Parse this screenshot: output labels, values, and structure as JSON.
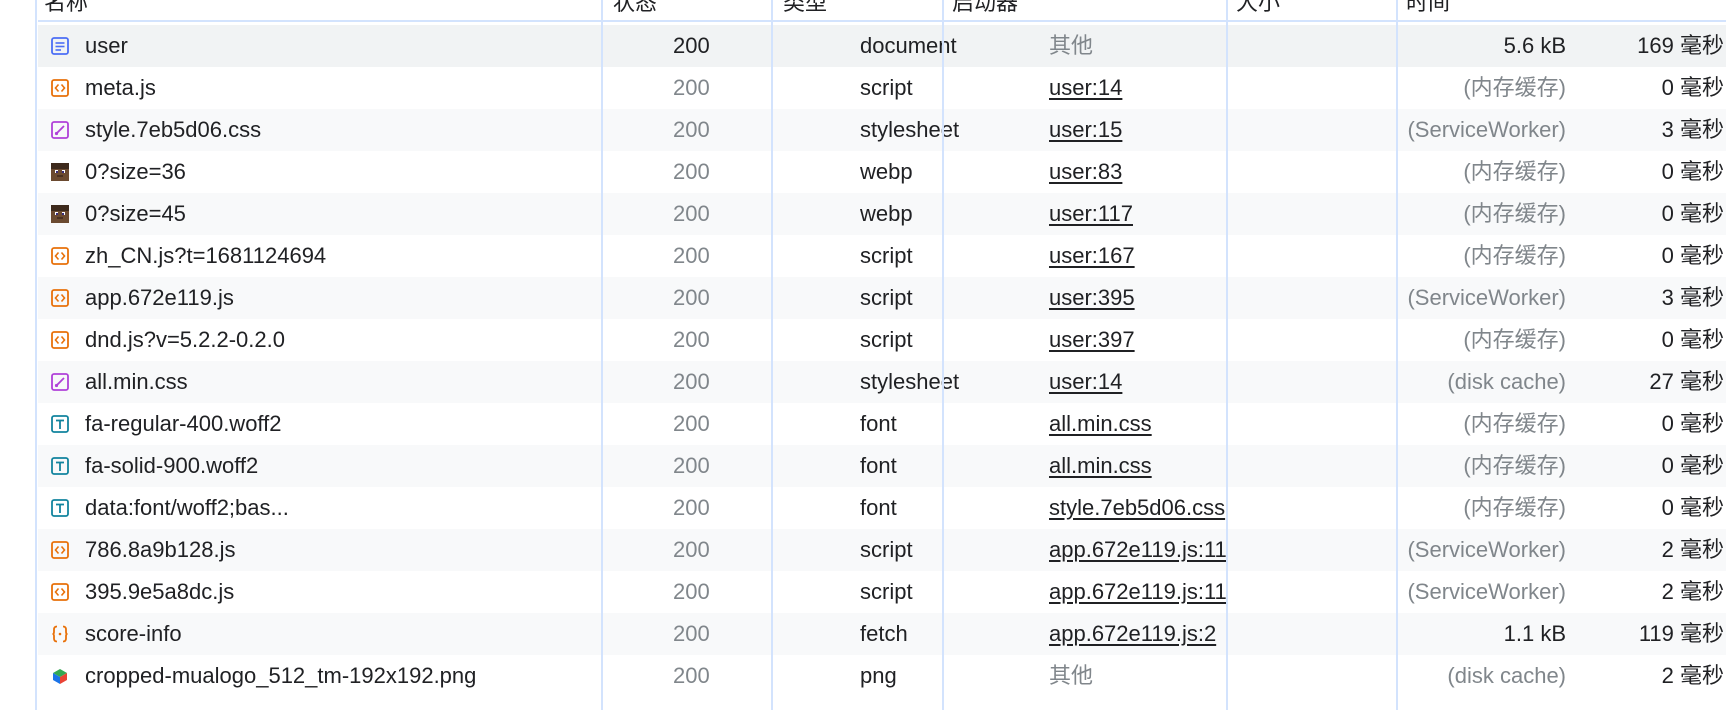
{
  "header": {
    "name": "名称",
    "status": "状态",
    "type": "类型",
    "initiator": "启动器",
    "size": "大小",
    "time": "时间"
  },
  "rows": [
    {
      "name": "user",
      "status": "200",
      "type": "document",
      "initiator": "其他",
      "initiator_link": false,
      "size": "5.6 kB",
      "size_dim": false,
      "time": "169 毫秒",
      "icon": "document-icon"
    },
    {
      "name": "meta.js",
      "status": "200",
      "type": "script",
      "initiator": "user:14",
      "initiator_link": true,
      "size": "(内存缓存)",
      "size_dim": true,
      "time": "0 毫秒",
      "icon": "script-icon"
    },
    {
      "name": "style.7eb5d06.css",
      "status": "200",
      "type": "stylesheet",
      "initiator": "user:15",
      "initiator_link": true,
      "size": "(ServiceWorker)",
      "size_dim": true,
      "time": "3 毫秒",
      "icon": "stylesheet-icon"
    },
    {
      "name": "0?size=36",
      "status": "200",
      "type": "webp",
      "initiator": "user:83",
      "initiator_link": true,
      "size": "(内存缓存)",
      "size_dim": true,
      "time": "0 毫秒",
      "icon": "avatar-image-icon"
    },
    {
      "name": "0?size=45",
      "status": "200",
      "type": "webp",
      "initiator": "user:117",
      "initiator_link": true,
      "size": "(内存缓存)",
      "size_dim": true,
      "time": "0 毫秒",
      "icon": "avatar-image-icon"
    },
    {
      "name": "zh_CN.js?t=1681124694",
      "status": "200",
      "type": "script",
      "initiator": "user:167",
      "initiator_link": true,
      "size": "(内存缓存)",
      "size_dim": true,
      "time": "0 毫秒",
      "icon": "script-icon"
    },
    {
      "name": "app.672e119.js",
      "status": "200",
      "type": "script",
      "initiator": "user:395",
      "initiator_link": true,
      "size": "(ServiceWorker)",
      "size_dim": true,
      "time": "3 毫秒",
      "icon": "script-icon"
    },
    {
      "name": "dnd.js?v=5.2.2-0.2.0",
      "status": "200",
      "type": "script",
      "initiator": "user:397",
      "initiator_link": true,
      "size": "(内存缓存)",
      "size_dim": true,
      "time": "0 毫秒",
      "icon": "script-icon"
    },
    {
      "name": "all.min.css",
      "status": "200",
      "type": "stylesheet",
      "initiator": "user:14",
      "initiator_link": true,
      "size": "(disk cache)",
      "size_dim": true,
      "time": "27 毫秒",
      "icon": "stylesheet-icon"
    },
    {
      "name": "fa-regular-400.woff2",
      "status": "200",
      "type": "font",
      "initiator": "all.min.css",
      "initiator_link": true,
      "size": "(内存缓存)",
      "size_dim": true,
      "time": "0 毫秒",
      "icon": "font-icon"
    },
    {
      "name": "fa-solid-900.woff2",
      "status": "200",
      "type": "font",
      "initiator": "all.min.css",
      "initiator_link": true,
      "size": "(内存缓存)",
      "size_dim": true,
      "time": "0 毫秒",
      "icon": "font-icon"
    },
    {
      "name": "data:font/woff2;bas...",
      "status": "200",
      "type": "font",
      "initiator": "style.7eb5d06.css",
      "initiator_link": true,
      "size": "(内存缓存)",
      "size_dim": true,
      "time": "0 毫秒",
      "icon": "font-icon"
    },
    {
      "name": "786.8a9b128.js",
      "status": "200",
      "type": "script",
      "initiator": "app.672e119.js:11",
      "initiator_link": true,
      "size": "(ServiceWorker)",
      "size_dim": true,
      "time": "2 毫秒",
      "icon": "script-icon"
    },
    {
      "name": "395.9e5a8dc.js",
      "status": "200",
      "type": "script",
      "initiator": "app.672e119.js:11",
      "initiator_link": true,
      "size": "(ServiceWorker)",
      "size_dim": true,
      "time": "2 毫秒",
      "icon": "script-icon"
    },
    {
      "name": "score-info",
      "status": "200",
      "type": "fetch",
      "initiator": "app.672e119.js:2",
      "initiator_link": true,
      "size": "1.1 kB",
      "size_dim": false,
      "time": "119 毫秒",
      "icon": "fetch-icon"
    },
    {
      "name": "cropped-mualogo_512_tm-192x192.png",
      "status": "200",
      "type": "png",
      "initiator": "其他",
      "initiator_link": false,
      "size": "(disk cache)",
      "size_dim": true,
      "time": "2 毫秒",
      "icon": "image-icon"
    }
  ],
  "colors": {
    "divider": "#d3e3fd",
    "script_icon": "#e8710a",
    "stylesheet_icon": "#b041d9",
    "font_icon": "#12849e",
    "document_icon": "#4c6ef5"
  }
}
